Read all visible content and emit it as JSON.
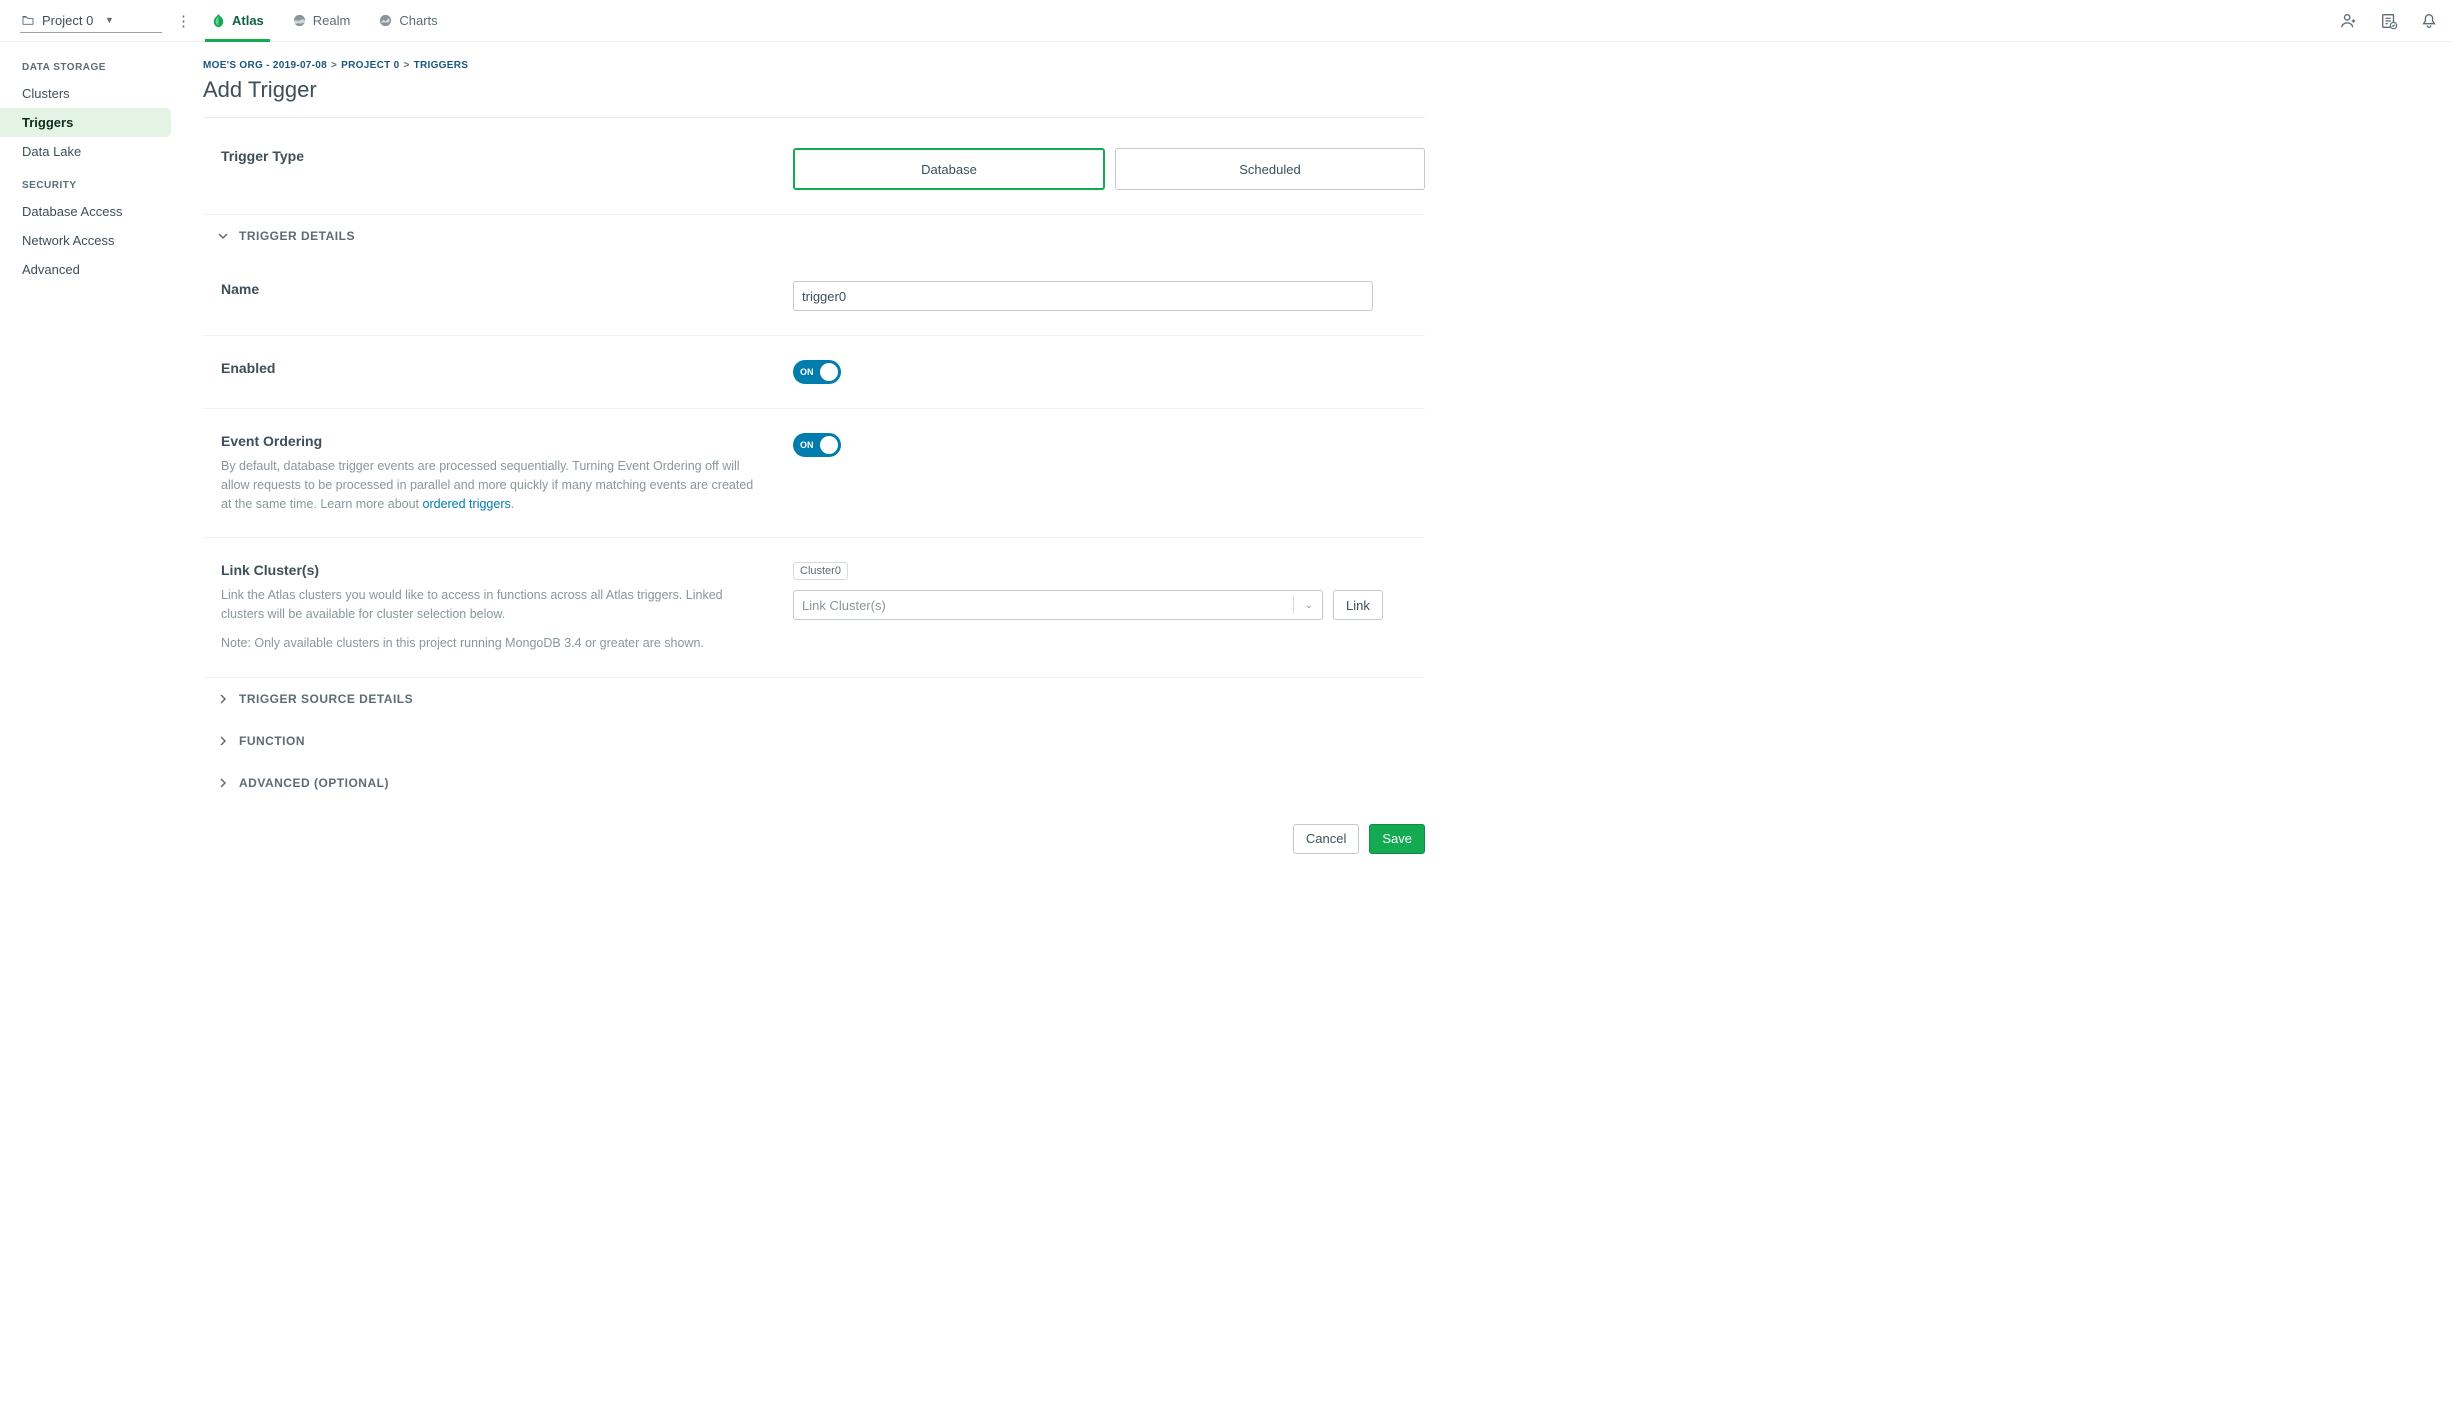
{
  "topnav": {
    "project_name": "Project 0",
    "tabs": [
      {
        "label": "Atlas",
        "active": true
      },
      {
        "label": "Realm",
        "active": false
      },
      {
        "label": "Charts",
        "active": false
      }
    ]
  },
  "sidebar": {
    "sections": [
      {
        "label": "DATA STORAGE",
        "items": [
          {
            "label": "Clusters"
          },
          {
            "label": "Triggers",
            "active": true
          },
          {
            "label": "Data Lake"
          }
        ]
      },
      {
        "label": "SECURITY",
        "items": [
          {
            "label": "Database Access"
          },
          {
            "label": "Network Access"
          },
          {
            "label": "Advanced"
          }
        ]
      }
    ]
  },
  "breadcrumb": {
    "parts": [
      "MOE'S ORG - 2019-07-08",
      "PROJECT 0",
      "TRIGGERS"
    ]
  },
  "page_title": "Add Trigger",
  "trigger_type": {
    "label": "Trigger Type",
    "options": [
      "Database",
      "Scheduled"
    ],
    "selected": "Database"
  },
  "sections": {
    "trigger_details": "TRIGGER DETAILS",
    "trigger_source_details": "TRIGGER SOURCE DETAILS",
    "function": "FUNCTION",
    "advanced": "ADVANCED (OPTIONAL)"
  },
  "fields": {
    "name": {
      "label": "Name",
      "value": "trigger0"
    },
    "enabled": {
      "label": "Enabled",
      "toggle_label": "ON"
    },
    "event_ordering": {
      "label": "Event Ordering",
      "desc_pre": "By default, database trigger events are processed sequentially. Turning Event Ordering off will allow requests to be processed in parallel and more quickly if many matching events are created at the same time. Learn more about ",
      "desc_link": "ordered triggers",
      "desc_post": ".",
      "toggle_label": "ON"
    },
    "link_clusters": {
      "label": "Link Cluster(s)",
      "desc1": "Link the Atlas clusters you would like to access in functions across all Atlas triggers. Linked clusters will be available for cluster selection below.",
      "desc2": "Note: Only available clusters in this project running MongoDB 3.4 or greater are shown.",
      "chip": "Cluster0",
      "placeholder": "Link Cluster(s)",
      "link_btn": "Link"
    }
  },
  "footer": {
    "cancel": "Cancel",
    "save": "Save"
  }
}
